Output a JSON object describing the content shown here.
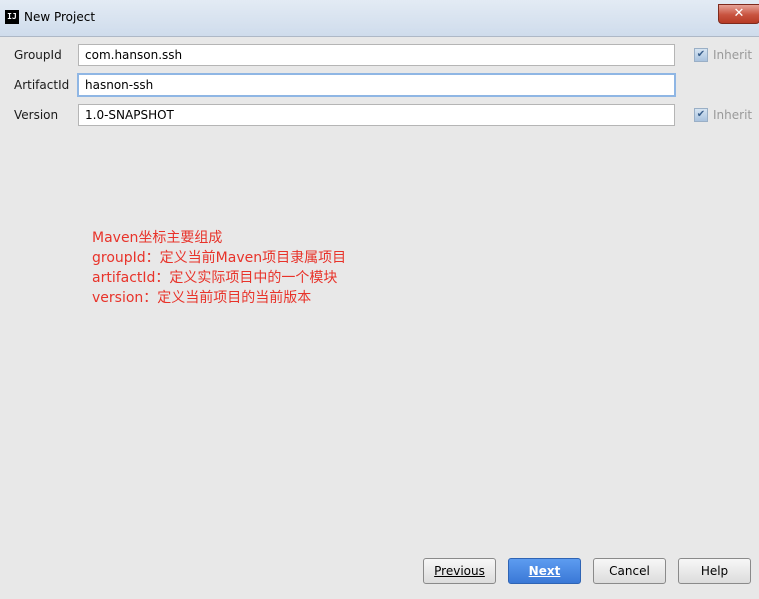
{
  "window": {
    "title": "New Project",
    "app_icon_text": "IJ",
    "close_glyph": "✕"
  },
  "form": {
    "group_id": {
      "label": "GroupId",
      "value": "com.hanson.ssh",
      "inherit_label": "Inherit",
      "inherit_checked": true
    },
    "artifact_id": {
      "label": "ArtifactId",
      "value": "hasnon-ssh"
    },
    "version": {
      "label": "Version",
      "value": "1.0-SNAPSHOT",
      "inherit_label": "Inherit",
      "inherit_checked": true
    }
  },
  "annotation": [
    "Maven坐标主要组成",
    "groupId：定义当前Maven项目隶属项目",
    "artifactId：定义实际项目中的一个模块",
    "version：定义当前项目的当前版本"
  ],
  "buttons": {
    "previous": {
      "label": "Previous"
    },
    "next": {
      "label": "Next"
    },
    "cancel": {
      "label": "Cancel"
    },
    "help": {
      "label": "Help"
    }
  },
  "colors": {
    "annotation": "#e8332a",
    "primary_button": "#3a78d6",
    "background": "#e8e8e8"
  },
  "icons": {
    "checkbox": "check-icon",
    "app": "intellij-icon",
    "close": "close-icon"
  }
}
